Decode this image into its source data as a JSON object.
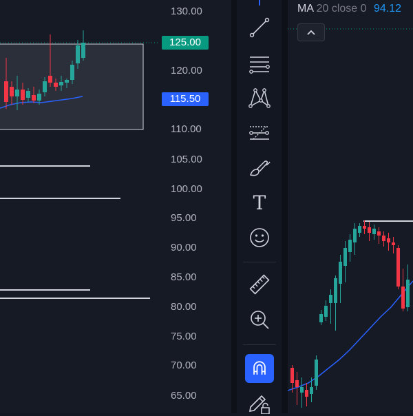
{
  "left_chart": {
    "price_ticks": [
      "130.00",
      "125.00",
      "120.00",
      "115.50",
      "110.00",
      "105.00",
      "100.00",
      "95.00",
      "90.00",
      "85.00",
      "80.00",
      "75.00",
      "70.00",
      "65.00"
    ],
    "current_price_label": "125.00",
    "current_price_color": "#089981",
    "target_price_label": "115.50",
    "target_price_color": "#2962ff",
    "up_color": "#26a69a",
    "down_color": "#f23645",
    "ma_color": "#2962ff"
  },
  "toolbar": {
    "tools": [
      {
        "icon": "trend-line-icon"
      },
      {
        "icon": "fib-retracement-icon"
      },
      {
        "icon": "xabcd-pattern-icon"
      },
      {
        "icon": "forecast-icon"
      },
      {
        "icon": "brush-icon"
      },
      {
        "icon": "text-icon"
      },
      {
        "icon": "emoji-icon"
      },
      {
        "icon": "ruler-icon"
      },
      {
        "icon": "zoom-in-icon"
      },
      {
        "icon": "magnet-icon",
        "active": true
      },
      {
        "icon": "lock-drawing-icon"
      }
    ],
    "text_tool_glyph": "T"
  },
  "right_chart": {
    "legend": {
      "name": "MA",
      "params": "20 close 0",
      "value": "94.12"
    },
    "ma_color": "#2962ff"
  }
}
